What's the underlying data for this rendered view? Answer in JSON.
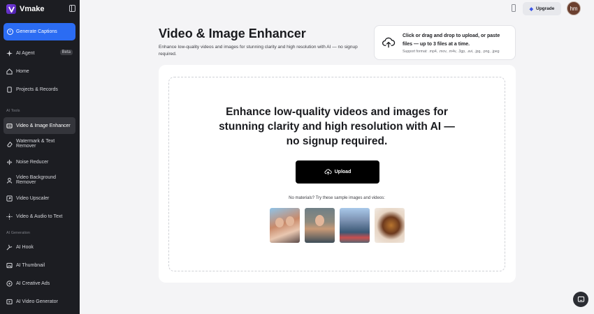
{
  "app": {
    "name": "Vmake",
    "accent": "#2b6cf3",
    "sidebar_bg": "#1c1d22"
  },
  "sidebar": {
    "primary_button": "Generate Captions",
    "items_top": [
      {
        "label": "AI Agent",
        "icon": "sparkle-icon",
        "badge": "Beta"
      },
      {
        "label": "Home",
        "icon": "home-icon"
      },
      {
        "label": "Projects & Records",
        "icon": "file-icon"
      }
    ],
    "section_tools": "AI Tools",
    "tools": [
      {
        "label": "Video & Image Enhancer",
        "icon": "enhance-icon",
        "active": true
      },
      {
        "label": "Watermark & Text Remover",
        "icon": "eraser-icon"
      },
      {
        "label": "Noise Reducer",
        "icon": "waveform-icon"
      },
      {
        "label": "Video Background Remover",
        "icon": "person-icon"
      },
      {
        "label": "Video Upscaler",
        "icon": "upscale-icon"
      },
      {
        "label": "Video & Audio to Text",
        "icon": "transcript-icon"
      }
    ],
    "section_generation": "AI Generation",
    "generation": [
      {
        "label": "AI Hook",
        "icon": "hook-icon"
      },
      {
        "label": "AI Thumbnail",
        "icon": "image-icon"
      },
      {
        "label": "AI Creative Ads",
        "icon": "ads-icon"
      },
      {
        "label": "AI Video Generator",
        "icon": "video-icon"
      }
    ]
  },
  "topbar": {
    "upgrade_label": "Upgrade",
    "avatar_initials": "hm"
  },
  "header": {
    "title": "Video & Image Enhancer",
    "description": "Enhance low-quality videos and images for stunning clarity and high resolution with AI — no signup required."
  },
  "dropzone": {
    "main_text": "Click or drag and drop to upload, or paste files — up to 3 files at a time.",
    "support_text": "Support format: .mp4, .mov, .m4v, .3gp, .avi, .jpg, .png, .jpeg"
  },
  "main": {
    "hero": "Enhance low-quality videos and images for stunning clarity and high resolution with AI — no signup required.",
    "upload_label": "Upload",
    "samples_label": "No materials? Try these sample images and videos:",
    "samples": [
      "sample-two-friends",
      "sample-woman-portrait",
      "sample-city-street",
      "sample-food-dish"
    ]
  }
}
